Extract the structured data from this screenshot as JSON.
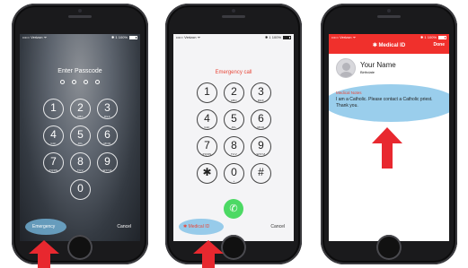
{
  "colors": {
    "arrow_red": "#e8282f",
    "highlight_blue": "#7dbfe6",
    "medical_red": "#f0302c",
    "call_green": "#4cd964"
  },
  "phone1": {
    "status_left": "••••○ Verizon ᯤ",
    "status_right": "✱ 1 100%",
    "title": "Enter Passcode",
    "keys": [
      {
        "digit": "1",
        "letters": ""
      },
      {
        "digit": "2",
        "letters": "ABC"
      },
      {
        "digit": "3",
        "letters": "DEF"
      },
      {
        "digit": "4",
        "letters": "GHI"
      },
      {
        "digit": "5",
        "letters": "JKL"
      },
      {
        "digit": "6",
        "letters": "MNO"
      },
      {
        "digit": "7",
        "letters": "PQRS"
      },
      {
        "digit": "8",
        "letters": "TUV"
      },
      {
        "digit": "9",
        "letters": "WXYZ"
      },
      {
        "digit": "0",
        "letters": ""
      }
    ],
    "emergency_label": "Emergency",
    "cancel_label": "Cancel"
  },
  "phone2": {
    "status_left": "••••○ Verizon ᯤ",
    "status_right": "✱ 1 100%",
    "title": "Emergency call",
    "keys": [
      {
        "digit": "1",
        "letters": ""
      },
      {
        "digit": "2",
        "letters": "ABC"
      },
      {
        "digit": "3",
        "letters": "DEF"
      },
      {
        "digit": "4",
        "letters": "GHI"
      },
      {
        "digit": "5",
        "letters": "JKL"
      },
      {
        "digit": "6",
        "letters": "MNO"
      },
      {
        "digit": "7",
        "letters": "PQRS"
      },
      {
        "digit": "8",
        "letters": "TUV"
      },
      {
        "digit": "9",
        "letters": "WXYZ"
      },
      {
        "digit": "✱",
        "letters": ""
      },
      {
        "digit": "0",
        "letters": "+"
      },
      {
        "digit": "#",
        "letters": ""
      }
    ],
    "call_icon": "✆",
    "medical_id_label": "✱ Medical ID",
    "cancel_label": "Cancel"
  },
  "phone3": {
    "status_left": "••••○ Verizon ᯤ",
    "status_right": "✱ 1 100%",
    "title": "✱ Medical ID",
    "done_label": "Done",
    "name": "Your Name",
    "birthdate_label": "Birthdate",
    "notes_label": "Medical Notes",
    "notes_text": "I am a Catholic. Please contact a Catholic priest. Thank you."
  }
}
